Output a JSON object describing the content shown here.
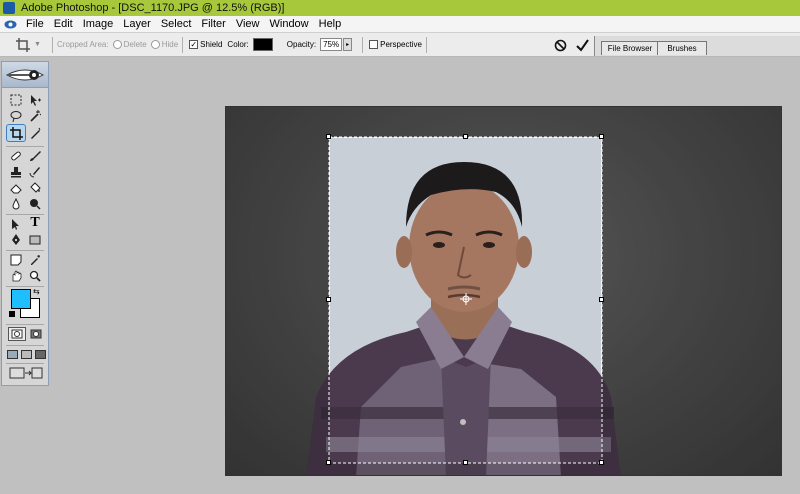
{
  "window": {
    "title": "Adobe Photoshop - [DSC_1170.JPG @ 12.5% (RGB)]"
  },
  "menu": [
    "File",
    "Edit",
    "Image",
    "Layer",
    "Select",
    "Filter",
    "View",
    "Window",
    "Help"
  ],
  "options": {
    "cropped_area_label": "Cropped Area:",
    "delete_label": "Delete",
    "hide_label": "Hide",
    "shield_label": "Shield",
    "color_label": "Color:",
    "opacity_label": "Opacity:",
    "opacity_value": "75%",
    "perspective_label": "Perspective",
    "shield_checked": true,
    "perspective_checked": false,
    "shield_color": "#000000"
  },
  "well": {
    "tabs": [
      "File Browser",
      "Brushes"
    ]
  },
  "toolbox": {
    "active_tool": "crop-tool",
    "foreground_color": "#1ebeff",
    "background_color": "#ffffff",
    "type_tool_glyph": "T"
  },
  "colors": {
    "titlebar": "#a6c83a",
    "canvas_bg": "#555555",
    "workspace": "#c0c0c0"
  }
}
